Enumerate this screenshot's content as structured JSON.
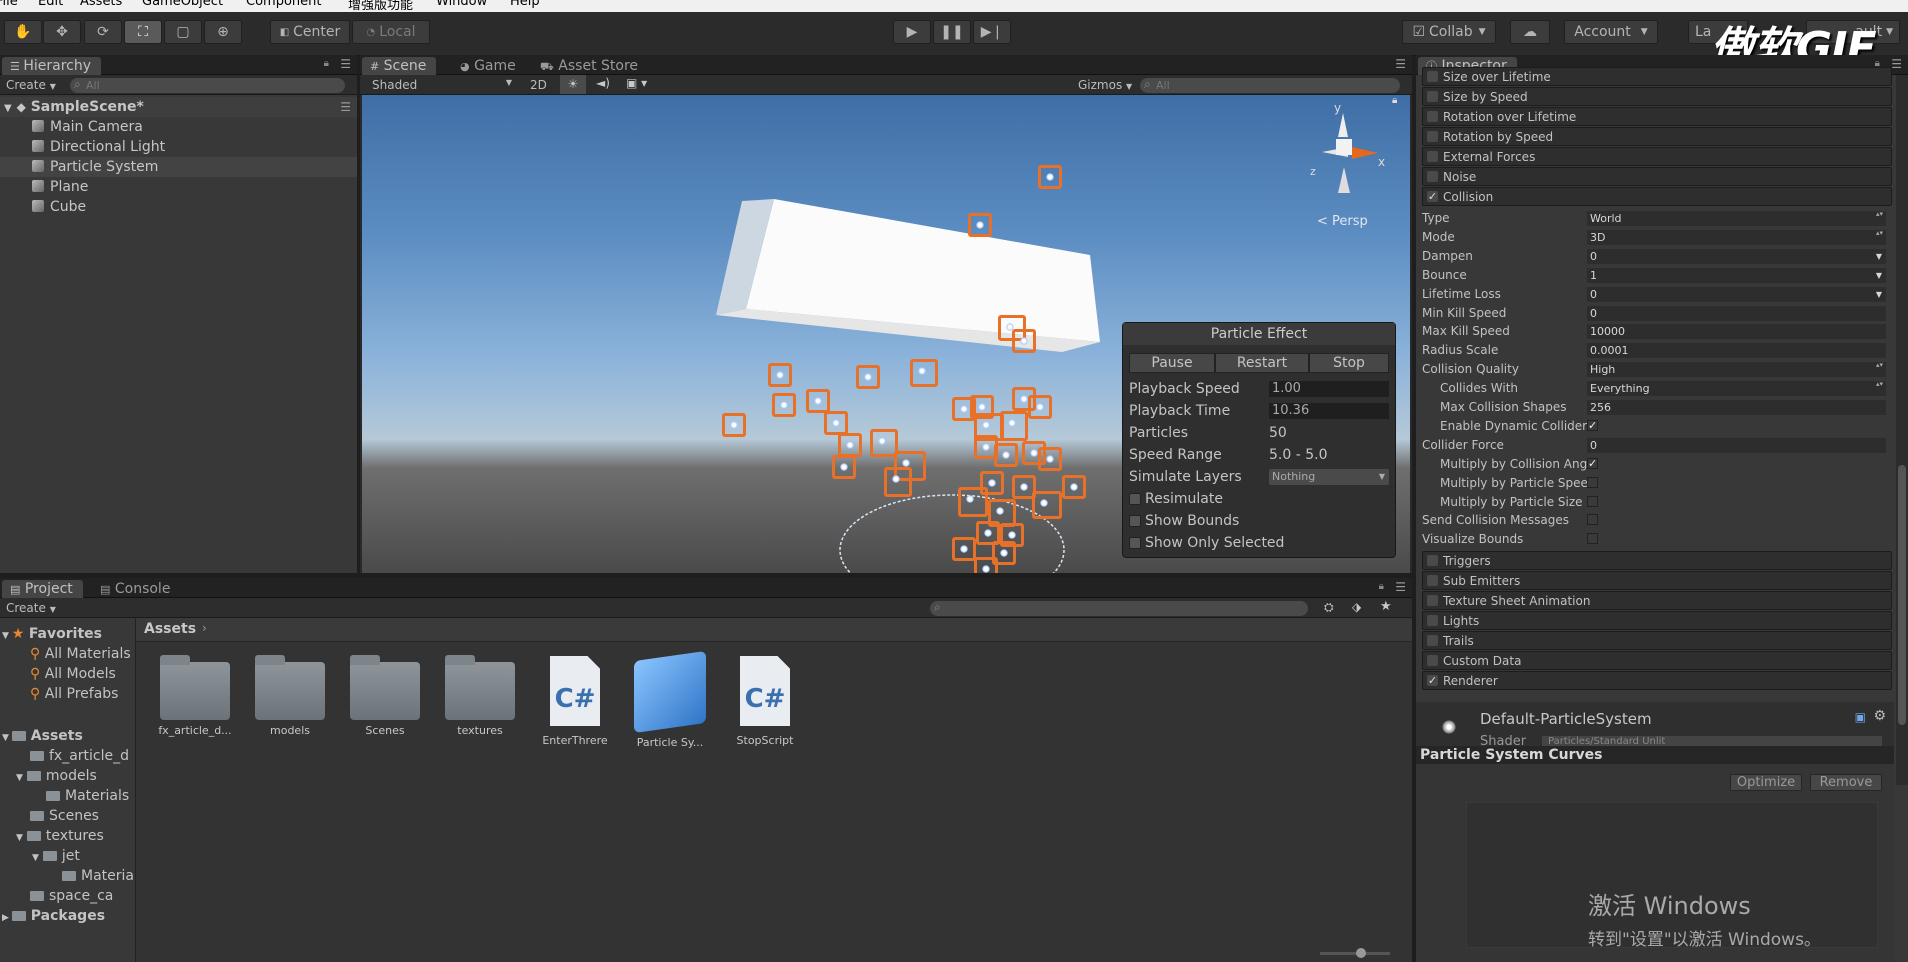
{
  "menubar": [
    "File",
    "Edit",
    "Assets",
    "GameObject",
    "Component",
    "增强版功能",
    "Window",
    "Help"
  ],
  "toolbar": {
    "pivot": "Center",
    "space": "Local",
    "collab": "Collab",
    "account": "Account",
    "layers": "La",
    "layout": "ault"
  },
  "watermark": "傲软GIF",
  "hierarchy": {
    "tab": "Hierarchy",
    "create": "Create",
    "search_placeholder": "All",
    "scene": "SampleScene*",
    "items": [
      "Main Camera",
      "Directional Light",
      "Particle System",
      "Plane",
      "Cube"
    ],
    "selected": "Particle System"
  },
  "scene_tabs": {
    "scene": "Scene",
    "game": "Game",
    "asset_store": "Asset Store",
    "shading": "Shaded",
    "mode_2d": "2D",
    "gizmos": "Gizmos",
    "search_placeholder": "All",
    "persp": "Persp",
    "axis_y": "y",
    "axis_z": "z",
    "axis_x": "x"
  },
  "particle_effect": {
    "title": "Particle Effect",
    "buttons": [
      "Pause",
      "Restart",
      "Stop"
    ],
    "playback_speed_label": "Playback Speed",
    "playback_speed": "1.00",
    "playback_time_label": "Playback Time",
    "playback_time": "10.36",
    "particles_label": "Particles",
    "particles": "50",
    "speed_range_label": "Speed Range",
    "speed_range": "5.0 - 5.0",
    "simulate_layers_label": "Simulate Layers",
    "simulate_layers": "Nothing",
    "resimulate": "Resimulate",
    "show_bounds": "Show Bounds",
    "show_only_selected": "Show Only Selected"
  },
  "inspector": {
    "tab": "Inspector",
    "modules_top": [
      {
        "label": "Size over Lifetime",
        "checked": false
      },
      {
        "label": "Size by Speed",
        "checked": false
      },
      {
        "label": "Rotation over Lifetime",
        "checked": false
      },
      {
        "label": "Rotation by Speed",
        "checked": false
      },
      {
        "label": "External Forces",
        "checked": false
      },
      {
        "label": "Noise",
        "checked": false
      },
      {
        "label": "Collision",
        "checked": true
      }
    ],
    "collision_props": [
      {
        "label": "Type",
        "value": "World",
        "kind": "dropdown"
      },
      {
        "label": "Mode",
        "value": "3D",
        "kind": "dropdown"
      },
      {
        "label": "Dampen",
        "value": "0",
        "kind": "curve"
      },
      {
        "label": "Bounce",
        "value": "1",
        "kind": "curve"
      },
      {
        "label": "Lifetime Loss",
        "value": "0",
        "kind": "curve"
      },
      {
        "label": "Min Kill Speed",
        "value": "0",
        "kind": "field"
      },
      {
        "label": "Max Kill Speed",
        "value": "10000",
        "kind": "field"
      },
      {
        "label": "Radius Scale",
        "value": "0.0001",
        "kind": "field"
      },
      {
        "label": "Collision Quality",
        "value": "High",
        "kind": "dropdown"
      },
      {
        "label": "Collides With",
        "value": "Everything",
        "kind": "dropdown",
        "indent": true
      },
      {
        "label": "Max Collision Shapes",
        "value": "256",
        "kind": "field",
        "indent": true
      },
      {
        "label": "Enable Dynamic Colliders",
        "value": "✓",
        "kind": "check",
        "indent": true
      },
      {
        "label": "Collider Force",
        "value": "0",
        "kind": "field"
      },
      {
        "label": "Multiply by Collision Angle",
        "value": "✓",
        "kind": "check",
        "indent": true
      },
      {
        "label": "Multiply by Particle Speed",
        "value": "",
        "kind": "check",
        "indent": true
      },
      {
        "label": "Multiply by Particle Size",
        "value": "",
        "kind": "check",
        "indent": true
      },
      {
        "label": "Send Collision Messages",
        "value": "",
        "kind": "check"
      },
      {
        "label": "Visualize Bounds",
        "value": "",
        "kind": "check"
      }
    ],
    "modules_bottom": [
      {
        "label": "Triggers",
        "checked": false
      },
      {
        "label": "Sub Emitters",
        "checked": false
      },
      {
        "label": "Texture Sheet Animation",
        "checked": false
      },
      {
        "label": "Lights",
        "checked": false
      },
      {
        "label": "Trails",
        "checked": false
      },
      {
        "label": "Custom Data",
        "checked": false
      },
      {
        "label": "Renderer",
        "checked": true
      }
    ],
    "material_name": "Default-ParticleSystem",
    "shader_label": "Shader",
    "shader_value": "Particles/Standard Unlit",
    "curves_title": "Particle System Curves",
    "optimize": "Optimize",
    "remove": "Remove"
  },
  "project": {
    "tab": "Project",
    "console_tab": "Console",
    "create": "Create",
    "favorites": "Favorites",
    "fav_items": [
      "All Materials",
      "All Models",
      "All Prefabs"
    ],
    "assets_root": "Assets",
    "tree": [
      {
        "label": "fx_article_d",
        "depth": 1
      },
      {
        "label": "models",
        "depth": 1
      },
      {
        "label": "Materials",
        "depth": 2
      },
      {
        "label": "Scenes",
        "depth": 1
      },
      {
        "label": "textures",
        "depth": 1
      },
      {
        "label": "jet",
        "depth": 2
      },
      {
        "label": "Materia",
        "depth": 3
      },
      {
        "label": "space_ca",
        "depth": 1
      }
    ],
    "packages": "Packages",
    "breadcrumb": "Assets",
    "assets": [
      {
        "label": "fx_article_d...",
        "kind": "folder"
      },
      {
        "label": "models",
        "kind": "folder"
      },
      {
        "label": "Scenes",
        "kind": "folder"
      },
      {
        "label": "textures",
        "kind": "folder"
      },
      {
        "label": "EnterThrere",
        "kind": "script"
      },
      {
        "label": "Particle Sy...",
        "kind": "prefab"
      },
      {
        "label": "StopScript",
        "kind": "script"
      }
    ],
    "cs_glyph": "C#"
  },
  "windows_activation": {
    "title": "激活 Windows",
    "subtitle": "转到\"设置\"以激活 Windows。"
  }
}
